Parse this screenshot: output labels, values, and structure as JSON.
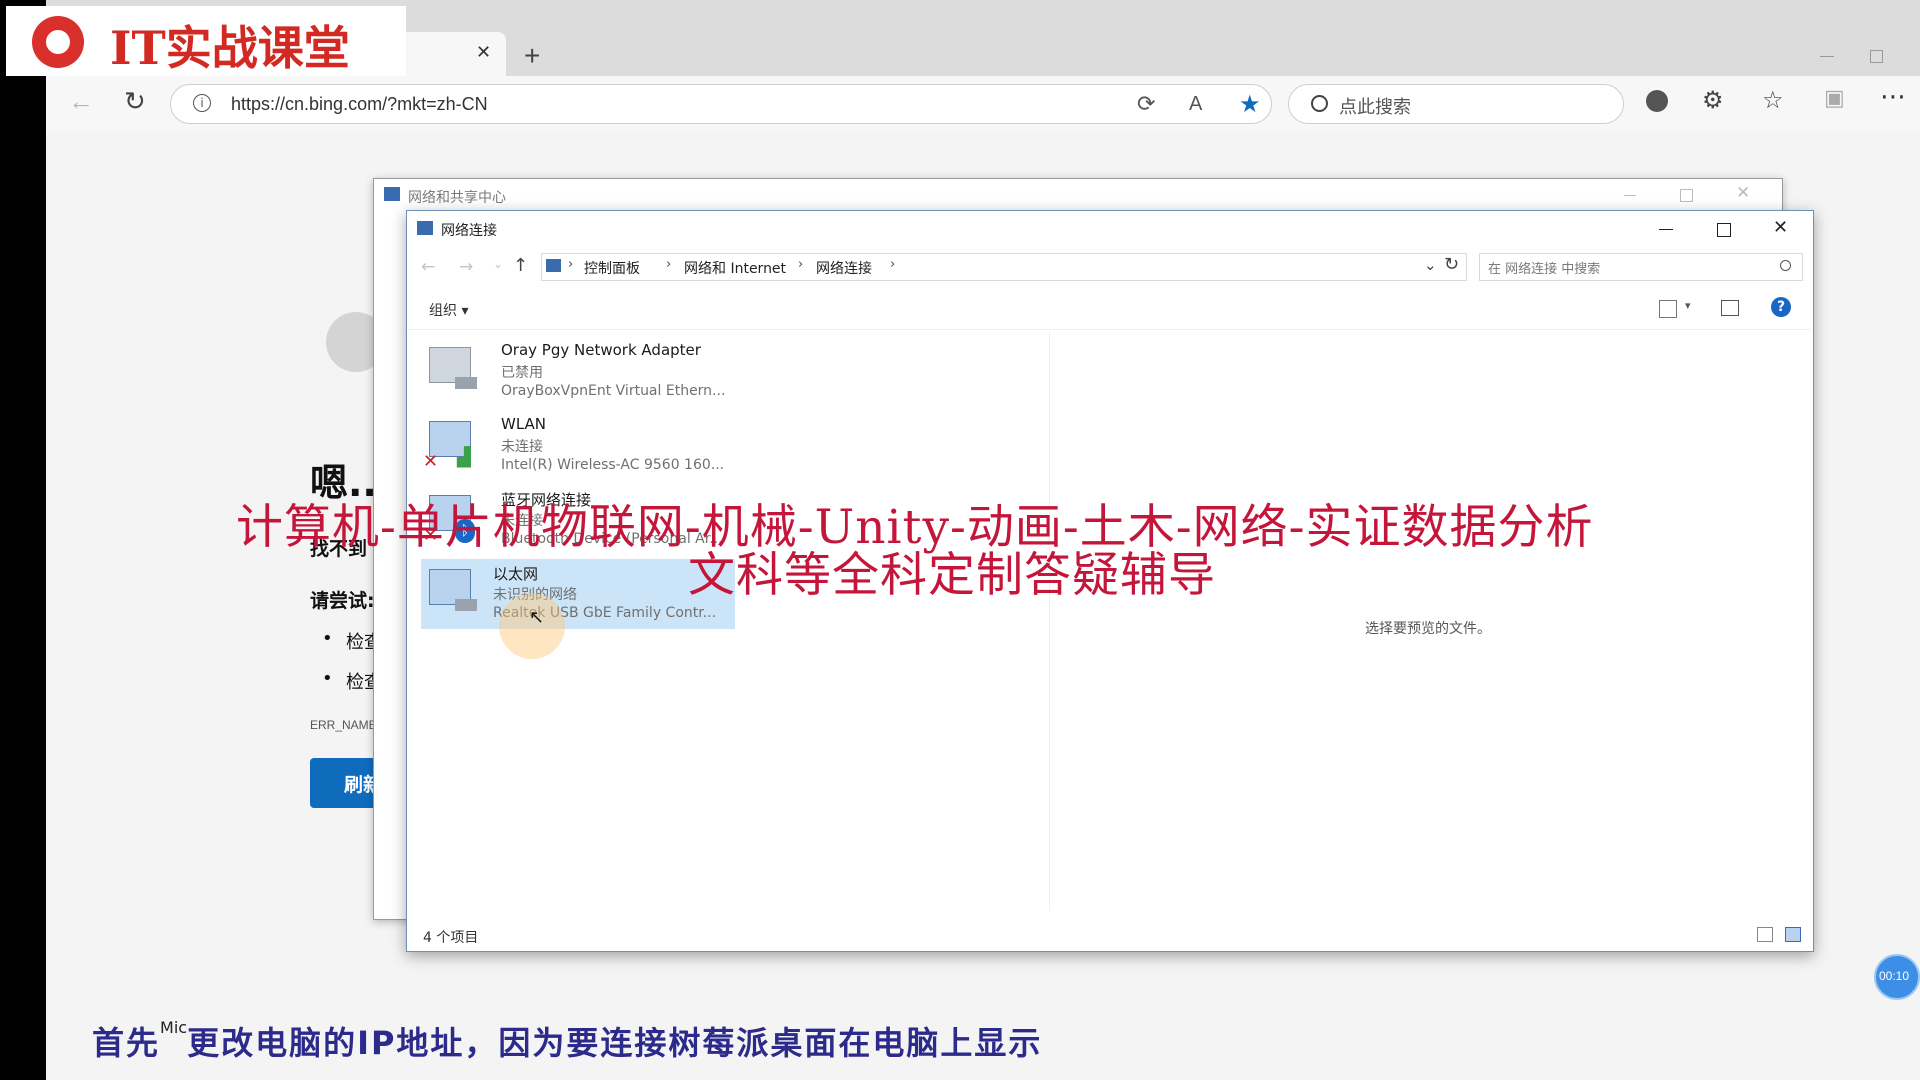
{
  "logo": {
    "text": "IT实战课堂"
  },
  "browser": {
    "close_tab": "✕",
    "new_tab": "+",
    "url": "https://cn.bing.com/?mkt=zh-CN",
    "search_placeholder": "点此搜索"
  },
  "bing_error": {
    "heading": "嗯...",
    "line1": "找不到",
    "try_label": "请尝试:",
    "bullet1": "检查",
    "bullet2": "检查",
    "error_code": "ERR_NAME_",
    "refresh_button": "刷新"
  },
  "back_window": {
    "title": "网络和共享中心"
  },
  "front_window": {
    "title": "网络连接",
    "breadcrumb": [
      "控制面板",
      "网络和 Internet",
      "网络连接"
    ],
    "search_placeholder": "在 网络连接 中搜索",
    "organize": "组织 ▾",
    "preview_hint": "选择要预览的文件。",
    "status_count": "4 个项目",
    "items": [
      {
        "name": "Oray Pgy Network Adapter",
        "status": "已禁用",
        "device": "OrayBoxVpnEnt Virtual Ethern..."
      },
      {
        "name": "WLAN",
        "status": "未连接",
        "device": "Intel(R) Wireless-AC 9560 160..."
      },
      {
        "name": "蓝牙网络连接",
        "status": "未连接",
        "device": "Bluetooth Device (Personal Ar..."
      },
      {
        "name": "以太网",
        "status": "未识别的网络",
        "device": "Realtek USB GbE Family Contr..."
      }
    ]
  },
  "overlay": {
    "line1": "计算机-单片机物联网-机械-Unity-动画-土木-网络-实证数据分析",
    "line2": "文科等全科定制答疑辅导"
  },
  "subtitle": {
    "prefix": "首先",
    "small": "Mic",
    "text": "更改电脑的IP地址，因为要连接树莓派桌面在电脑上显示"
  },
  "timer": "00:10",
  "colors": {
    "accent": "#0f6cbd",
    "overlay_red": "#c4163a",
    "subtitle_blue": "#2c2a8a"
  }
}
